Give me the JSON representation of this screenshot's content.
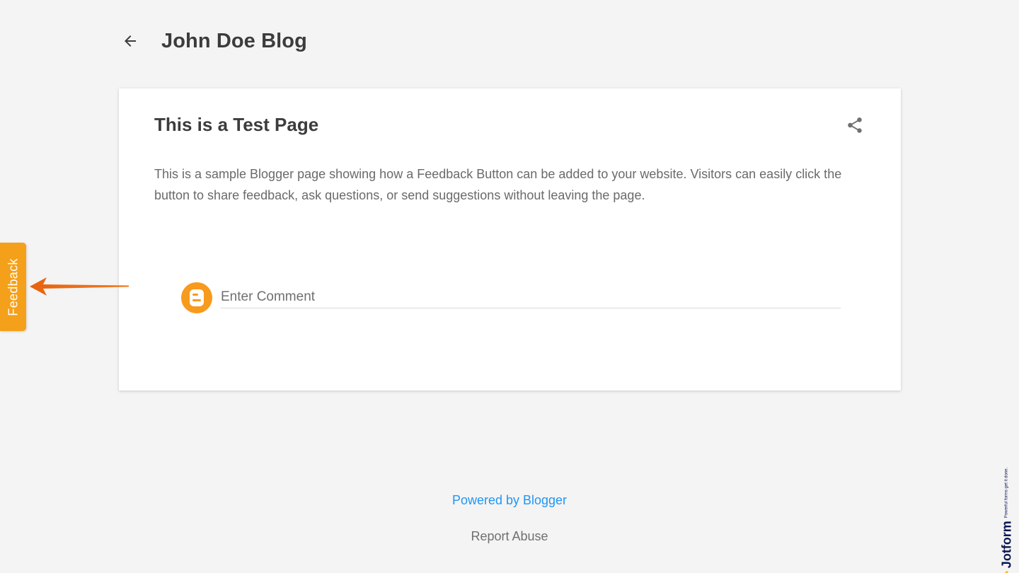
{
  "header": {
    "blog_title": "John Doe Blog",
    "back_icon": "arrow-left-icon"
  },
  "post": {
    "title": "This is a Test Page",
    "body": "This is a sample Blogger page showing how a Feedback Button can be added to your website. Visitors can easily click the button to share feedback, ask questions, or send suggestions without leaving the page.",
    "share_icon": "share-icon"
  },
  "comment": {
    "placeholder": "Enter Comment",
    "avatar_icon": "blogger-logo-icon"
  },
  "feedback": {
    "label": "Feedback",
    "color": "#f5a01a",
    "arrow_color": "#e8620f"
  },
  "footer": {
    "powered_by": "Powered by Blogger",
    "report_abuse": "Report Abuse",
    "link_color": "#2196f3"
  },
  "badge": {
    "name": "Jotform",
    "tagline": "Powerful forms get it done."
  }
}
